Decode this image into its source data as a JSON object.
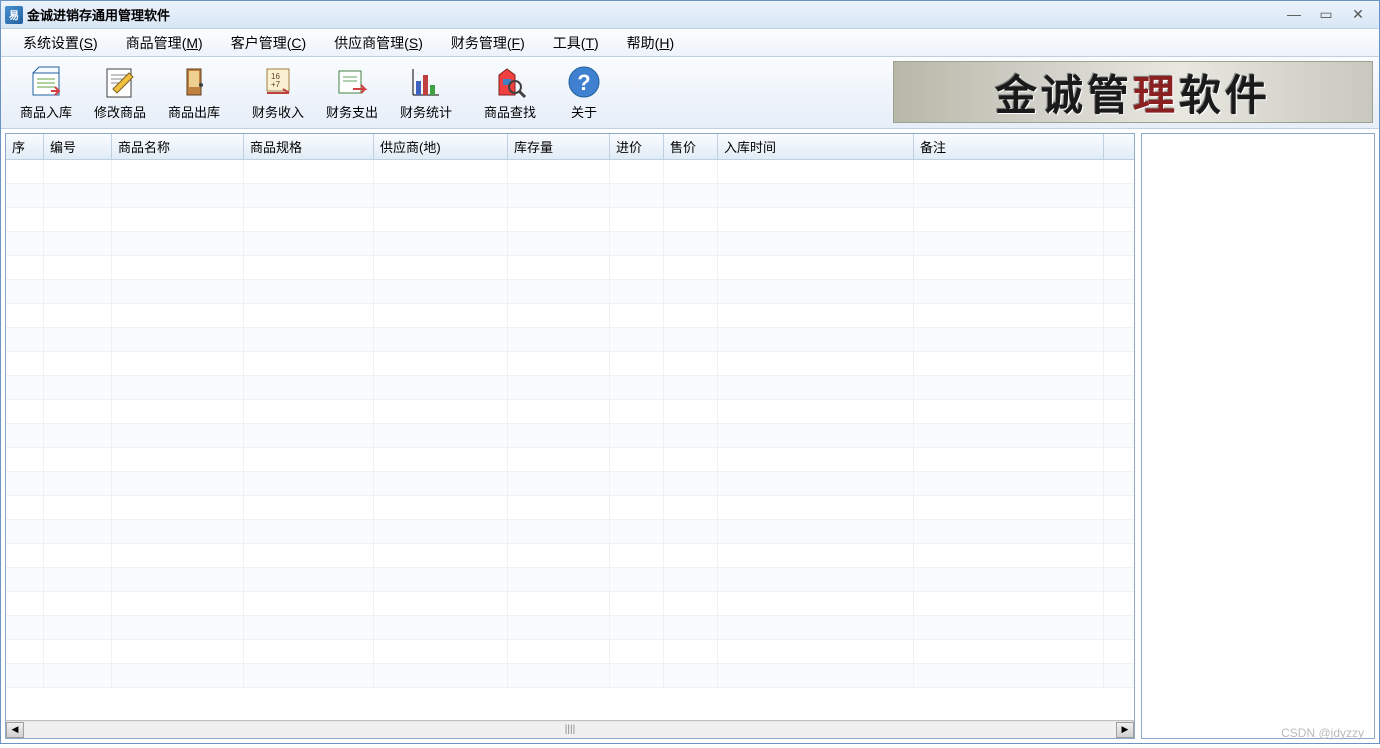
{
  "title": "金诚进销存通用管理软件",
  "menu": [
    {
      "label": "系统设置",
      "hotkey": "S"
    },
    {
      "label": "商品管理",
      "hotkey": "M"
    },
    {
      "label": "客户管理",
      "hotkey": "C"
    },
    {
      "label": "供应商管理",
      "hotkey": "S"
    },
    {
      "label": "财务管理",
      "hotkey": "F"
    },
    {
      "label": "工具",
      "hotkey": "T"
    },
    {
      "label": "帮助",
      "hotkey": "H"
    }
  ],
  "toolbar": [
    {
      "name": "goods-in",
      "label": "商品入库",
      "icon": "inbox-icon"
    },
    {
      "name": "goods-edit",
      "label": "修改商品",
      "icon": "edit-icon"
    },
    {
      "name": "goods-out",
      "label": "商品出库",
      "icon": "outbox-icon"
    },
    {
      "name": "finance-in",
      "label": "财务收入",
      "icon": "ledger-in-icon"
    },
    {
      "name": "finance-out",
      "label": "财务支出",
      "icon": "ledger-out-icon"
    },
    {
      "name": "finance-stat",
      "label": "财务统计",
      "icon": "chart-icon"
    },
    {
      "name": "goods-search",
      "label": "商品查找",
      "icon": "search-icon"
    },
    {
      "name": "about",
      "label": "关于",
      "icon": "help-icon"
    }
  ],
  "banner": {
    "text_a": "金诚管",
    "text_b": "理",
    "text_c": "软件"
  },
  "columns": [
    "序",
    "编号",
    "商品名称",
    "商品规格",
    "供应商(地)",
    "库存量",
    "进价",
    "售价",
    "入库时间",
    "备注"
  ],
  "rows": [],
  "watermark": "CSDN @jdyzzy"
}
